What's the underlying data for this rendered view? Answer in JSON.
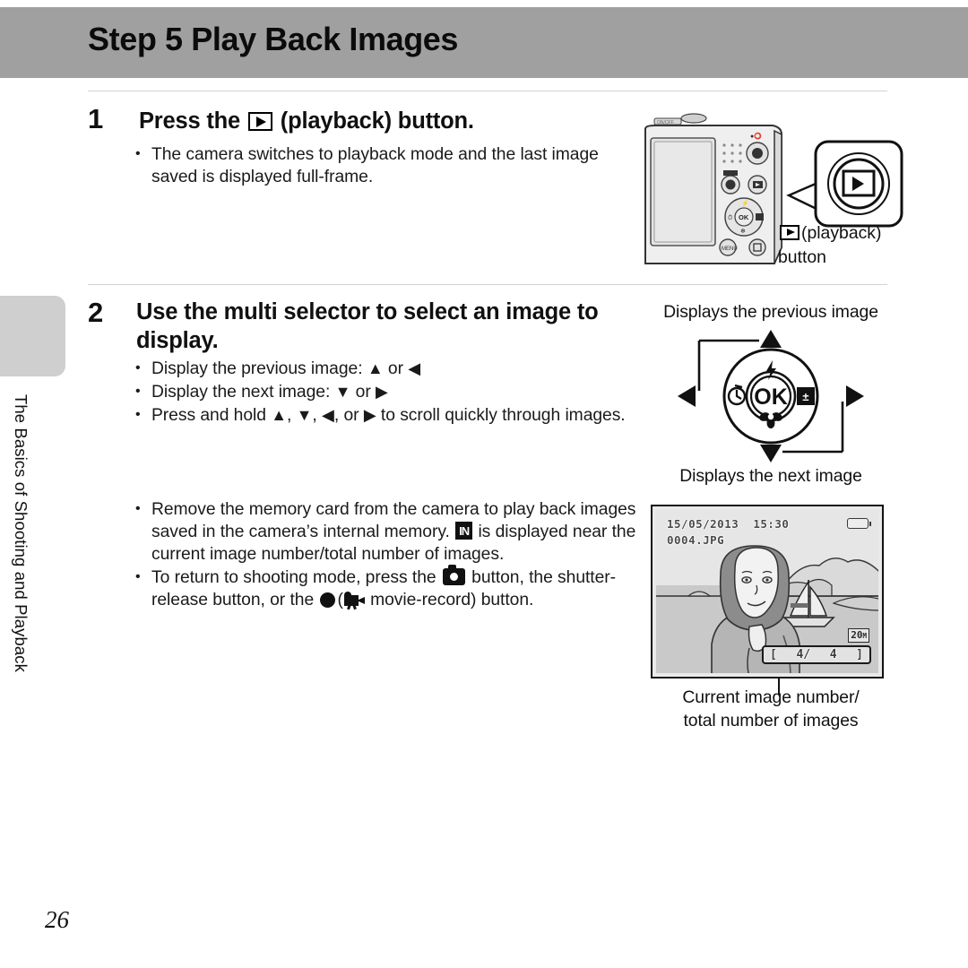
{
  "header": {
    "title": "Step 5 Play Back Images",
    "band_color": "#a0a0a0"
  },
  "side_tab": {
    "label": "The Basics of Shooting and Playback",
    "tab_color": "#cfcfcf"
  },
  "steps": [
    {
      "number": "1",
      "heading_pre": "Press the",
      "heading_post": "(playback) button.",
      "bullets": [
        "The camera switches to playback mode and the last image saved is displayed full-frame."
      ]
    },
    {
      "number": "2",
      "heading": "Use the multi selector to select an image to display.",
      "bullets_group_a": [
        {
          "pre": "Display the previous image:",
          "a1": "▲",
          "mid": "or",
          "a2": "◀",
          "post": ""
        },
        {
          "pre": "Display the next image:",
          "a1": "▼",
          "mid": "or",
          "a2": "▶",
          "post": ""
        }
      ],
      "bullet_hold": {
        "pre": "Press and hold",
        "a1": "▲",
        "a2": "▼",
        "a3": "◀",
        "mid": ", or",
        "a4": "▶",
        "post": "to scroll quickly through images."
      },
      "bullets_group_b": {
        "memory": {
          "pre": "Remove the memory card from the camera to play back images saved in the camera’s internal memory.",
          "icon": "internal-memory-IN",
          "post": "is displayed near the current image number/total number of images."
        },
        "shooting": {
          "pre": "To return to shooting mode, press the",
          "icon1": "camera-mode",
          "mid1": "button, the shutter-release button, or the",
          "icon2": "record-dot",
          "mid2": "(",
          "icon3": "movie-camera",
          "post": "movie-record) button."
        }
      }
    }
  ],
  "figures": {
    "playback_button": {
      "callout_label_pre": "",
      "callout_label_post": "(playback)",
      "callout_label_line2": "button",
      "icon": "playback-triangle-box"
    },
    "multi_selector": {
      "top_caption": "Displays the previous image",
      "bottom_caption": "Displays the next image",
      "center_label": "OK",
      "top_icon": "flash-icon",
      "left_icon": "self-timer-icon",
      "right_icon": "exposure-compensation-icon",
      "bottom_icon": "macro-flower-icon"
    },
    "lcd_monitor": {
      "date": "15/05/2013",
      "time": "15:30",
      "filename": "0004.JPG",
      "image_size_badge": "20",
      "image_size_badge_sub": "M",
      "counter_left": "[",
      "counter_current": "4/",
      "counter_total": "4",
      "counter_right": "]",
      "battery_icon": "battery-icon",
      "caption_line1": "Current image number/",
      "caption_line2": "total number of images"
    }
  },
  "footer": {
    "page_number": "26"
  }
}
